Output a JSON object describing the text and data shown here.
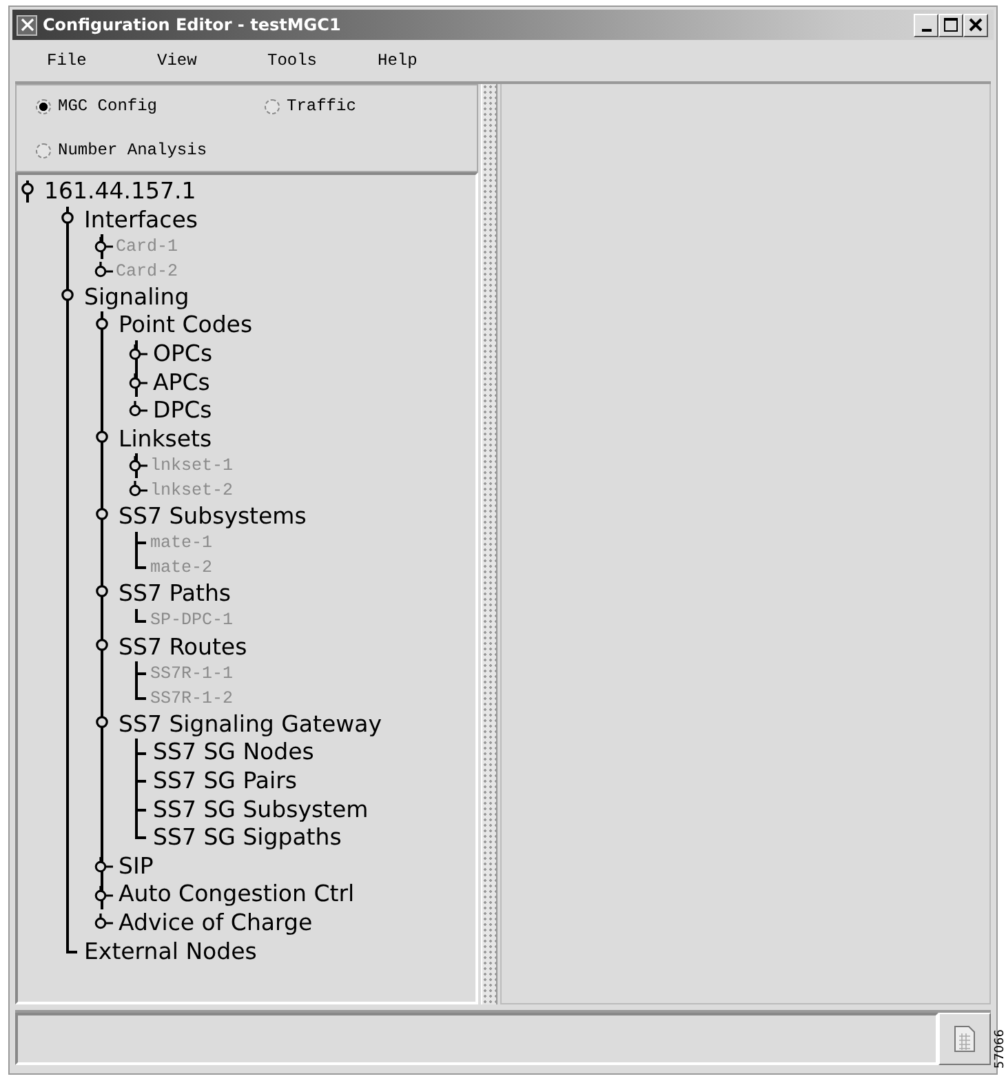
{
  "window": {
    "title": "Configuration Editor - testMGC1"
  },
  "menu": [
    "File",
    "View",
    "Tools",
    "Help"
  ],
  "modes": [
    {
      "label": "MGC Config",
      "selected": true
    },
    {
      "label": "Traffic",
      "selected": false
    },
    {
      "label": "Number Analysis",
      "selected": false
    }
  ],
  "tree": {
    "label": "161.44.157.1",
    "kind": "folder",
    "expanded": true,
    "disabled": false,
    "children": [
      {
        "label": "Interfaces",
        "kind": "folder",
        "expanded": true,
        "disabled": false,
        "children": [
          {
            "label": "Card-1",
            "kind": "folder",
            "expanded": false,
            "disabled": true
          },
          {
            "label": "Card-2",
            "kind": "folder",
            "expanded": false,
            "disabled": true
          }
        ]
      },
      {
        "label": "Signaling",
        "kind": "folder",
        "expanded": true,
        "disabled": false,
        "children": [
          {
            "label": "Point Codes",
            "kind": "folder",
            "expanded": true,
            "disabled": false,
            "children": [
              {
                "label": "OPCs",
                "kind": "folder",
                "expanded": false,
                "disabled": false
              },
              {
                "label": "APCs",
                "kind": "folder",
                "expanded": false,
                "disabled": false
              },
              {
                "label": "DPCs",
                "kind": "folder",
                "expanded": false,
                "disabled": false
              }
            ]
          },
          {
            "label": "Linksets",
            "kind": "folder",
            "expanded": true,
            "disabled": false,
            "children": [
              {
                "label": "lnkset-1",
                "kind": "folder",
                "expanded": false,
                "disabled": true
              },
              {
                "label": "lnkset-2",
                "kind": "folder",
                "expanded": false,
                "disabled": true
              }
            ]
          },
          {
            "label": "SS7 Subsystems",
            "kind": "folder",
            "expanded": true,
            "disabled": false,
            "children": [
              {
                "label": "mate-1",
                "kind": "leaf",
                "disabled": true
              },
              {
                "label": "mate-2",
                "kind": "leaf",
                "disabled": true
              }
            ]
          },
          {
            "label": "SS7 Paths",
            "kind": "folder",
            "expanded": true,
            "disabled": false,
            "children": [
              {
                "label": "SP-DPC-1",
                "kind": "leaf",
                "disabled": true
              }
            ]
          },
          {
            "label": "SS7 Routes",
            "kind": "folder",
            "expanded": true,
            "disabled": false,
            "children": [
              {
                "label": "SS7R-1-1",
                "kind": "leaf",
                "disabled": true
              },
              {
                "label": "SS7R-1-2",
                "kind": "leaf",
                "disabled": true
              }
            ]
          },
          {
            "label": "SS7 Signaling Gateway",
            "kind": "folder",
            "expanded": true,
            "disabled": false,
            "children": [
              {
                "label": "SS7 SG Nodes",
                "kind": "leaf",
                "disabled": false
              },
              {
                "label": "SS7 SG Pairs",
                "kind": "leaf",
                "disabled": false
              },
              {
                "label": "SS7 SG Subsystem",
                "kind": "leaf",
                "disabled": false
              },
              {
                "label": "SS7 SG Sigpaths",
                "kind": "leaf",
                "disabled": false
              }
            ]
          },
          {
            "label": "SIP",
            "kind": "folder",
            "expanded": false,
            "disabled": false
          },
          {
            "label": "Auto Congestion Ctrl",
            "kind": "folder",
            "expanded": false,
            "disabled": false
          },
          {
            "label": "Advice of Charge",
            "kind": "folder",
            "expanded": false,
            "disabled": false
          }
        ]
      },
      {
        "label": "External Nodes",
        "kind": "leaf",
        "disabled": false
      }
    ]
  },
  "figure_id": "57066"
}
